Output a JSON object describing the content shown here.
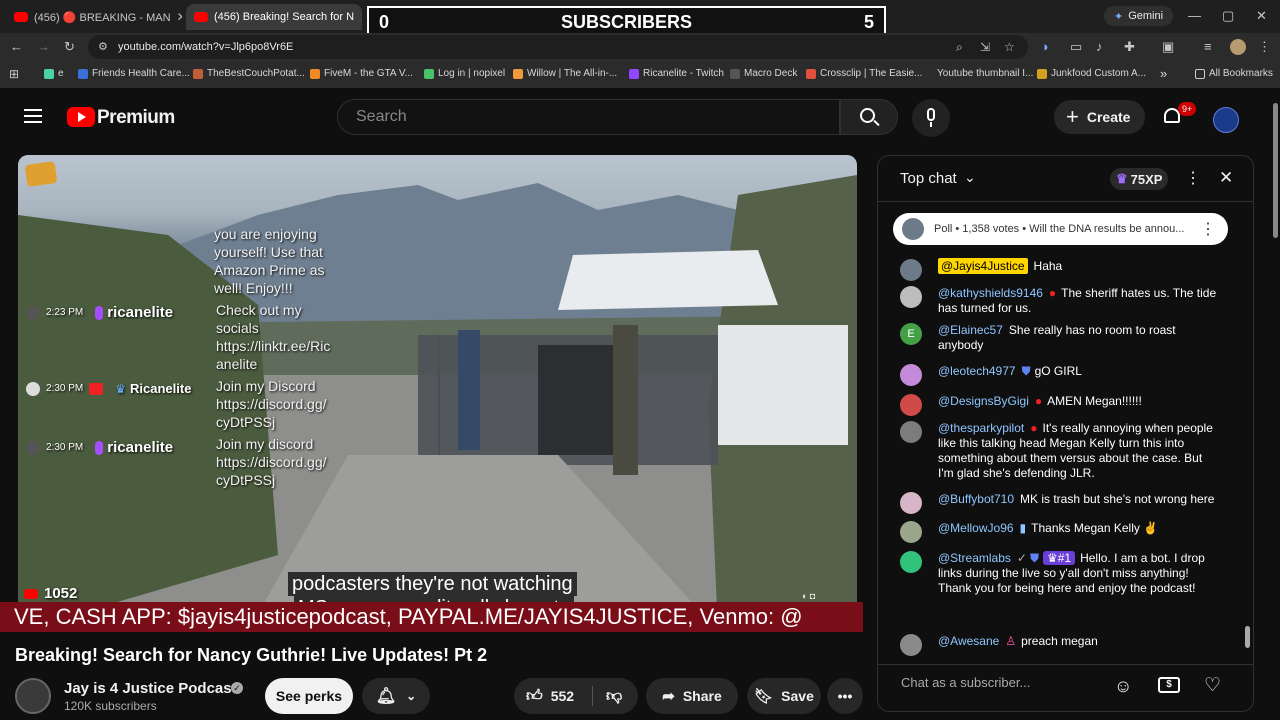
{
  "browser": {
    "tabs": [
      {
        "label": "(456) 🔴 BREAKING - MAN"
      },
      {
        "label": "(456) Breaking! Search for N"
      }
    ],
    "overlay": {
      "left": "0",
      "label": "SUBSCRIBERS",
      "right": "5"
    },
    "gemini_label": "Gemini",
    "url": "youtube.com/watch?v=Jlp6po8Vr6E",
    "bookmarks": [
      {
        "label": "e"
      },
      {
        "label": "Friends Health Care..."
      },
      {
        "label": "TheBestCouchPotat..."
      },
      {
        "label": "FiveM - the GTA V..."
      },
      {
        "label": "Log in | nopixel"
      },
      {
        "label": "Willow | The All-in-..."
      },
      {
        "label": "Ricanelite - Twitch"
      },
      {
        "label": "Macro Deck"
      },
      {
        "label": "Crossclip | The Easie..."
      },
      {
        "label": "Youtube thumbnail I..."
      },
      {
        "label": "Junkfood Custom A..."
      }
    ],
    "all_bookmarks": "All Bookmarks",
    "more_bookmarks": "»"
  },
  "youtube": {
    "logo_text": "Premium",
    "search_placeholder": "Search",
    "create_label": "Create",
    "notif_count": "9+"
  },
  "video": {
    "overlay_lines": [
      "you are enjoying",
      "yourself! Use that",
      "Amazon Prime as",
      "well! Enjoy!!!",
      "Check out my",
      "socials",
      "https://linktr.ee/Ric",
      "anelite",
      "Join my Discord",
      "https://discord.gg/",
      "cyDtPSSj",
      "Join my discord",
      "https://discord.gg/",
      "cyDtPSSj"
    ],
    "stream_chat": [
      {
        "time": "2:23 PM",
        "name": "ricanelite"
      },
      {
        "time": "2:30 PM",
        "name": "Ricanelite"
      },
      {
        "time": "2:30 PM",
        "name": "ricanelite"
      }
    ],
    "viewer_count": "1052",
    "caption_line1": "podcasters they're not watching",
    "caption_line2": "MS now you re literally have to",
    "ticker": "VE, CASH APP: $jayis4justicepodcast, PAYPAL.ME/JAYIS4JUSTICE, Venmo: @"
  },
  "meta": {
    "title": "Breaking! Search for Nancy Guthrie! Live Updates! Pt 2",
    "channel": "Jay is 4 Justice Podcast",
    "subscribers": "120K subscribers",
    "perks_label": "See perks",
    "likes": "552",
    "share_label": "Share",
    "save_label": "Save"
  },
  "chat": {
    "header": "Top chat",
    "xp": "75XP",
    "poll": "Poll • 1,358 votes • Will the DNA results be annou...",
    "messages": [
      {
        "author": "@Jayis4Justice",
        "text": "Haha",
        "color": "#6c7a89",
        "kind": "owner"
      },
      {
        "author": "@kathyshields9146",
        "text": "The sheriff hates us. The tide has turned for us.",
        "color": "#bdbdbd",
        "kind": "user"
      },
      {
        "author": "@Elainec57",
        "text": "She really has no room to roast anybody",
        "color": "#43a047",
        "kind": "user"
      },
      {
        "author": "@leotech4977",
        "text": "gO GIRL",
        "color": "#c48bd8",
        "kind": "mod"
      },
      {
        "author": "@DesignsByGigi",
        "text": "AMEN Megan!!!!!!",
        "color": "#d14a4a",
        "kind": "user"
      },
      {
        "author": "@thesparkypilot",
        "text": "It's really annoying when people like this talking head Megan Kelly turn this into something about them versus about the case. But I'm glad she's defending JLR.",
        "color": "#7c7c7c",
        "kind": "user"
      },
      {
        "author": "@Buffybot710",
        "text": "MK is trash but she's not wrong here",
        "color": "#d8b4c8",
        "kind": "user"
      },
      {
        "author": "@MellowJo96",
        "text": "Thanks Megan Kelly ✌",
        "color": "#9aa58a",
        "kind": "user"
      },
      {
        "author": "@Streamlabs",
        "text": "Hello. I am a bot.  I drop links during the live so y'all don't miss anything! Thank you for being here and enjoy the podcast!",
        "color": "#31c27c",
        "kind": "mod"
      },
      {
        "author": "@Awesane",
        "text": "preach megan",
        "color": "#8a8a8a",
        "kind": "user"
      }
    ],
    "input_placeholder": "Chat as a subscriber..."
  }
}
